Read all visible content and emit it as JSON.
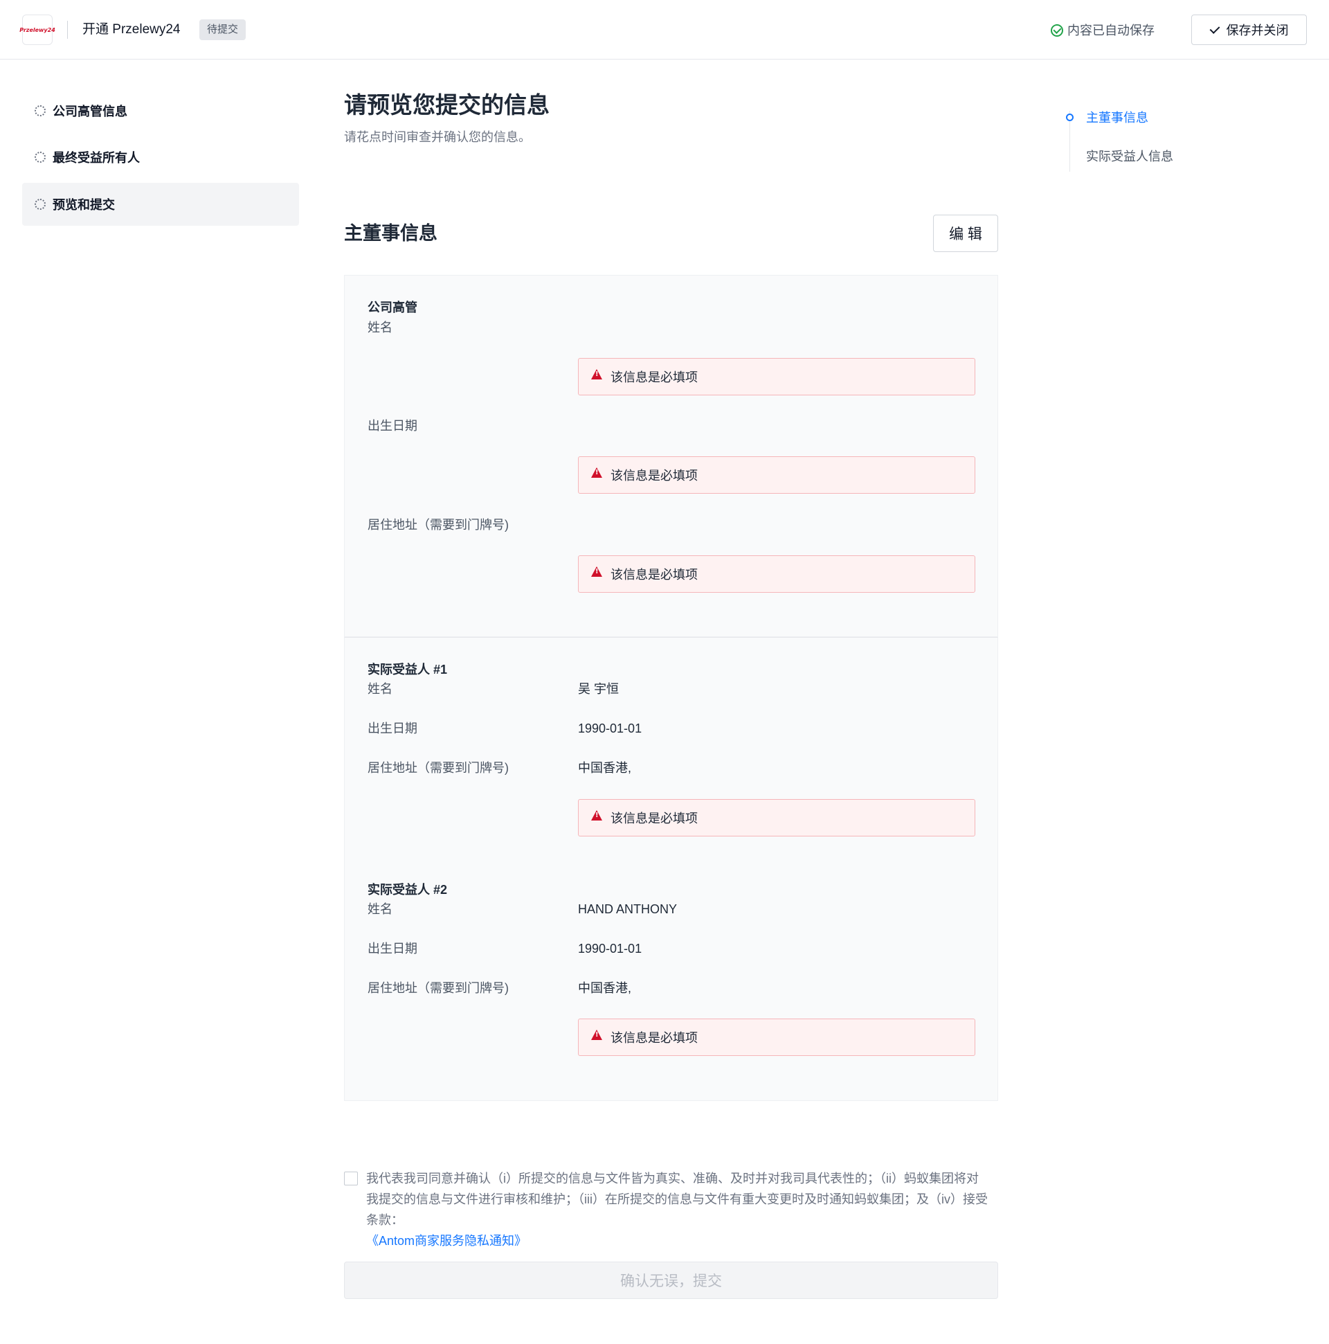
{
  "header": {
    "logo_text": "Przelewy24",
    "app_title": "开通 Przelewy24",
    "status": "待提交",
    "autosave": "内容已自动保存",
    "save_close": "保存并关闭"
  },
  "sidebar": {
    "items": [
      {
        "label": "公司高管信息"
      },
      {
        "label": "最终受益所有人"
      },
      {
        "label": "预览和提交"
      }
    ]
  },
  "main": {
    "title": "请预览您提交的信息",
    "subtitle": "请花点时间审查并确认您的信息。",
    "section_title": "主董事信息",
    "edit_label": "编 辑",
    "groups": [
      {
        "title": "公司高管",
        "name_label": "姓名",
        "dob_label": "出生日期",
        "address_label": "居住地址（需要到门牌号)",
        "name_error": "该信息是必填项",
        "dob_error": "该信息是必填项",
        "address_error": "该信息是必填项"
      },
      {
        "title": "实际受益人 #1",
        "name_label": "姓名",
        "name_value": "吴 宇恒",
        "dob_label": "出生日期",
        "dob_value": "1990-01-01",
        "address_label": "居住地址（需要到门牌号)",
        "address_value": "中国香港,",
        "address_error": "该信息是必填项"
      },
      {
        "title": "实际受益人 #2",
        "name_label": "姓名",
        "name_value": "HAND ANTHONY",
        "dob_label": "出生日期",
        "dob_value": "1990-01-01",
        "address_label": "居住地址（需要到门牌号)",
        "address_value": "中国香港,",
        "address_error": "该信息是必填项"
      }
    ]
  },
  "anchor_nav": {
    "items": [
      {
        "label": "主董事信息"
      },
      {
        "label": "实际受益人信息"
      }
    ]
  },
  "agreement": {
    "text": "我代表我司同意并确认（i）所提交的信息与文件皆为真实、准确、及时并对我司具代表性的；（ii）蚂蚁集团将对我提交的信息与文件进行审核和维护；（iii）在所提交的信息与文件有重大变更时及时通知蚂蚁集团；及（iv）接受条款：",
    "link": "《Antom商家服务隐私通知》",
    "submit": "确认无误，提交"
  },
  "colors": {
    "accent": "#1677ff",
    "error": "#d0112b",
    "success": "#22a34a"
  }
}
